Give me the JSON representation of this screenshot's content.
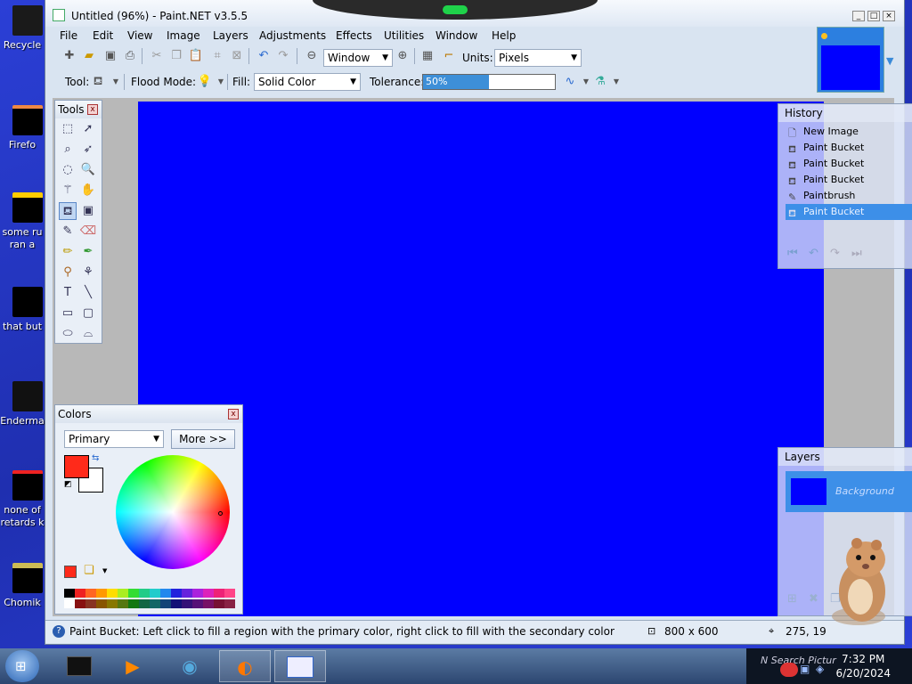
{
  "desktop": {
    "icons": [
      {
        "label": "Recycle"
      },
      {
        "label": "Firefo"
      },
      {
        "label": "some ru\nran a"
      },
      {
        "label": "that but"
      },
      {
        "label": "Enderma"
      },
      {
        "label": "none of\nretards k"
      },
      {
        "label": "Chomik"
      }
    ]
  },
  "window": {
    "title": "Untitled (96%) - Paint.NET v3.5.5",
    "menu": [
      "File",
      "Edit",
      "View",
      "Image",
      "Layers",
      "Adjustments",
      "Effects",
      "Utilities",
      "Window",
      "Help"
    ]
  },
  "toolbar1": {
    "zoom_value": "Window",
    "units_label": "Units:",
    "units_value": "Pixels"
  },
  "toolbar2": {
    "tool_label": "Tool:",
    "flood_label": "Flood Mode:",
    "fill_label": "Fill:",
    "fill_value": "Solid Color",
    "tolerance_label": "Tolerance:",
    "tolerance_text": "50%",
    "tolerance_value": 0.5
  },
  "tools_panel": {
    "title": "Tools",
    "close": "x"
  },
  "history_panel": {
    "title": "History",
    "close": "x",
    "items": [
      {
        "label": "New Image",
        "selected": false
      },
      {
        "label": "Paint Bucket",
        "selected": false
      },
      {
        "label": "Paint Bucket",
        "selected": false
      },
      {
        "label": "Paint Bucket",
        "selected": false
      },
      {
        "label": "Paintbrush",
        "selected": false
      },
      {
        "label": "Paint Bucket",
        "selected": true
      }
    ]
  },
  "colors_panel": {
    "title": "Colors",
    "close": "x",
    "mode_value": "Primary",
    "more_label": "More >>",
    "primary_color": "#ff2a1a",
    "secondary_color": "#ffffff"
  },
  "layers_panel": {
    "title": "Layers",
    "close": "x",
    "layer_name": "Background",
    "layer_color": "#0000ff"
  },
  "canvas": {
    "color": "#0000ff"
  },
  "statusbar": {
    "hint": "Paint Bucket: Left click to fill a region with the primary color, right click to fill with the secondary color",
    "size": "800 x 600",
    "coords": "275, 19"
  },
  "taskbar": {
    "time": "7:32 PM",
    "date": "6/20/2024",
    "tray_text": "N Search Pictur"
  }
}
